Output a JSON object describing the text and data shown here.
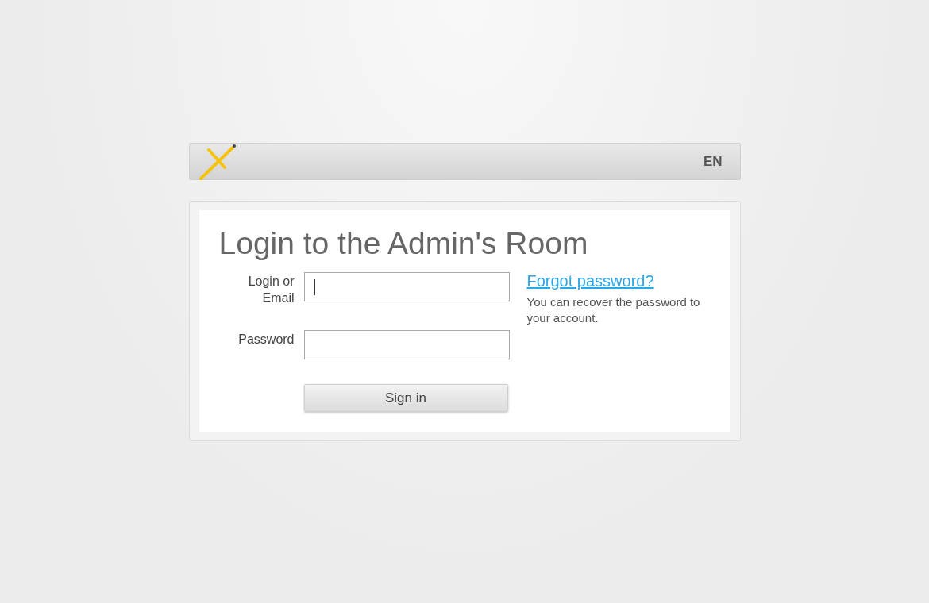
{
  "header": {
    "language": "EN"
  },
  "title": "Login to the Admin's Room",
  "fields": [
    {
      "label": "Login or Email",
      "focused": true
    },
    {
      "label": "Password",
      "focused": false
    }
  ],
  "submit": "Sign in",
  "help": {
    "link": "Forgot password?",
    "text": "You can recover the password to your account."
  }
}
